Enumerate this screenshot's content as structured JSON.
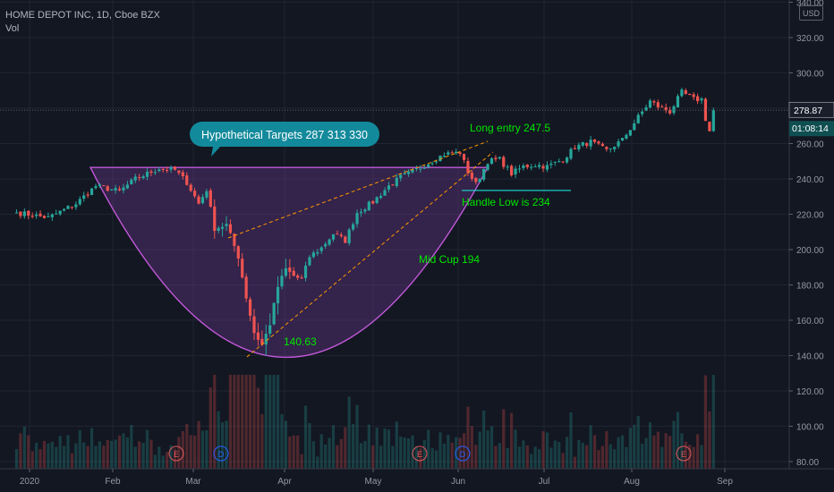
{
  "header": {
    "symbol_line": "HOME DEPOT INC, 1D, Cboe BZX",
    "volume_label": "Vol",
    "currency_button": "USD"
  },
  "price_tag": {
    "last_price": "278.87",
    "countdown": "01:08:14"
  },
  "colors": {
    "background": "#131722",
    "grid": "#1f2431",
    "up": "#26a69a",
    "down": "#ef5350",
    "annotation_green": "#00e600",
    "callout": "#138a9b",
    "cup_fill": "#7b3f9e",
    "dashed_line": "#ff9800",
    "handle_line": "#1ec8c8"
  },
  "chart_data": {
    "type": "candlestick",
    "title": "HOME DEPOT INC, 1D, Cboe BZX",
    "y_axis": {
      "range": [
        78,
        345
      ],
      "ticks": [
        "340.00",
        "320.00",
        "300.00",
        "280.00",
        "260.00",
        "240.00",
        "220.00",
        "200.00",
        "180.00",
        "160.00",
        "140.00",
        "120.00",
        "100.00",
        "80.00"
      ]
    },
    "x_axis": {
      "ticks": [
        "2020",
        "Feb",
        "Mar",
        "Apr",
        "May",
        "Jun",
        "Jul",
        "Aug",
        "Sep"
      ]
    },
    "price_anchors": [
      {
        "day": 0,
        "close": 221
      },
      {
        "day": 8,
        "close": 218
      },
      {
        "day": 15,
        "close": 226
      },
      {
        "day": 20,
        "close": 236
      },
      {
        "day": 26,
        "close": 233
      },
      {
        "day": 30,
        "close": 240
      },
      {
        "day": 36,
        "close": 246
      },
      {
        "day": 40,
        "close": 245
      },
      {
        "day": 43,
        "close": 238
      },
      {
        "day": 46,
        "close": 226
      },
      {
        "day": 48,
        "close": 234
      },
      {
        "day": 50,
        "close": 212
      },
      {
        "day": 53,
        "close": 214
      },
      {
        "day": 56,
        "close": 196
      },
      {
        "day": 58,
        "close": 173
      },
      {
        "day": 60,
        "close": 153
      },
      {
        "day": 62,
        "close": 146
      },
      {
        "day": 64,
        "close": 158
      },
      {
        "day": 66,
        "close": 179
      },
      {
        "day": 68,
        "close": 189
      },
      {
        "day": 70,
        "close": 185
      },
      {
        "day": 72,
        "close": 183
      },
      {
        "day": 74,
        "close": 196
      },
      {
        "day": 77,
        "close": 201
      },
      {
        "day": 80,
        "close": 209
      },
      {
        "day": 83,
        "close": 205
      },
      {
        "day": 86,
        "close": 221
      },
      {
        "day": 90,
        "close": 227
      },
      {
        "day": 94,
        "close": 236
      },
      {
        "day": 97,
        "close": 241
      },
      {
        "day": 100,
        "close": 244
      },
      {
        "day": 104,
        "close": 249
      },
      {
        "day": 108,
        "close": 254
      },
      {
        "day": 112,
        "close": 255
      },
      {
        "day": 114,
        "close": 244
      },
      {
        "day": 116,
        "close": 237
      },
      {
        "day": 119,
        "close": 250
      },
      {
        "day": 122,
        "close": 251
      },
      {
        "day": 125,
        "close": 243
      },
      {
        "day": 128,
        "close": 247
      },
      {
        "day": 131,
        "close": 248
      },
      {
        "day": 134,
        "close": 247
      },
      {
        "day": 138,
        "close": 251
      },
      {
        "day": 141,
        "close": 258
      },
      {
        "day": 145,
        "close": 261
      },
      {
        "day": 149,
        "close": 256
      },
      {
        "day": 153,
        "close": 262
      },
      {
        "day": 157,
        "close": 275
      },
      {
        "day": 160,
        "close": 284
      },
      {
        "day": 162,
        "close": 281
      },
      {
        "day": 165,
        "close": 278
      },
      {
        "day": 168,
        "close": 289
      },
      {
        "day": 171,
        "close": 285
      },
      {
        "day": 173,
        "close": 285
      },
      {
        "day": 174,
        "close": 274
      },
      {
        "day": 175,
        "close": 267
      },
      {
        "day": 176,
        "close": 278.87
      }
    ],
    "earnings_markers": [
      "E",
      "E",
      "E"
    ],
    "dividend_markers": [
      "D",
      "D"
    ],
    "annotations": {
      "callout": "Hypothetical Targets 287 313 330",
      "long_entry": "Long entry 247.5",
      "handle_low": "Handle Low is  234",
      "mid_cup": "Mid Cup 194",
      "low": "140.63"
    },
    "levels": {
      "cup_rim": 246.5,
      "cup_bottom": 139,
      "handle_low": 234,
      "long_entry": 247.5
    },
    "grid": true
  }
}
